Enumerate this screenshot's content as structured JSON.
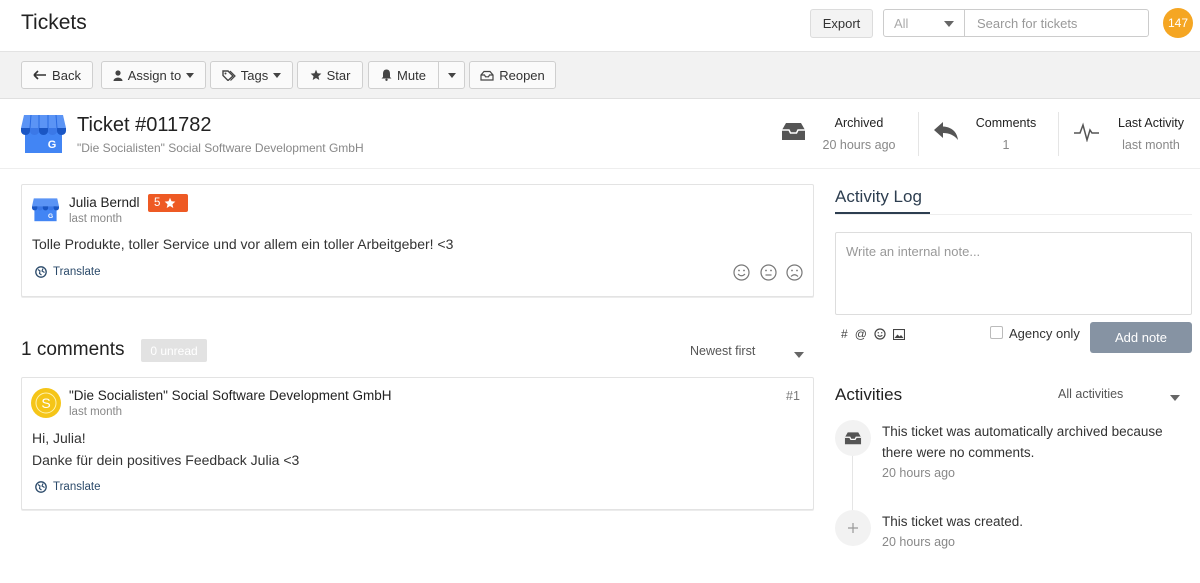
{
  "header": {
    "title": "Tickets",
    "export_label": "Export",
    "filter_value": "All",
    "search_placeholder": "Search for tickets",
    "notification_count": "147"
  },
  "toolbar": {
    "back": "Back",
    "assign": "Assign to",
    "tags": "Tags",
    "star": "Star",
    "mute": "Mute",
    "reopen": "Reopen"
  },
  "ticket": {
    "title": "Ticket #011782",
    "company": "\"Die Socialisten\" Social Software Development GmbH",
    "stats": [
      {
        "label": "Archived",
        "value": "20 hours ago",
        "icon": "inbox-icon"
      },
      {
        "label": "Comments",
        "value": "1",
        "icon": "reply-icon"
      },
      {
        "label": "Last Activity",
        "value": "last month",
        "icon": "pulse-icon"
      }
    ]
  },
  "review": {
    "author": "Julia Berndl",
    "time": "last month",
    "rating": "5",
    "text": "Tolle Produkte, toller Service und vor allem ein toller Arbeitgeber! <3",
    "translate": "Translate"
  },
  "comments": {
    "title": "1 comments",
    "unread": "0 unread",
    "sort": "Newest first",
    "items": [
      {
        "author": "\"Die Socialisten\" Social Software Development GmbH",
        "time": "last month",
        "number": "#1",
        "lines": [
          "Hi, Julia!",
          "Danke für dein positives Feedback Julia <3"
        ],
        "translate": "Translate"
      }
    ]
  },
  "activity_log": {
    "tab": "Activity Log",
    "note_placeholder": "Write an internal note...",
    "agency_only": "Agency only",
    "add_note": "Add note"
  },
  "activities": {
    "title": "Activities",
    "filter": "All activities",
    "items": [
      {
        "text": "This ticket was automatically archived because there were no comments.",
        "time": "20 hours ago",
        "icon": "inbox-icon"
      },
      {
        "text": "This ticket was created.",
        "time": "20 hours ago",
        "icon": "plus-icon"
      }
    ]
  },
  "colors": {
    "accent": "#2d3e50",
    "badge": "#f5a623",
    "rating": "#ee5a24",
    "add_note": "#8693a3"
  }
}
